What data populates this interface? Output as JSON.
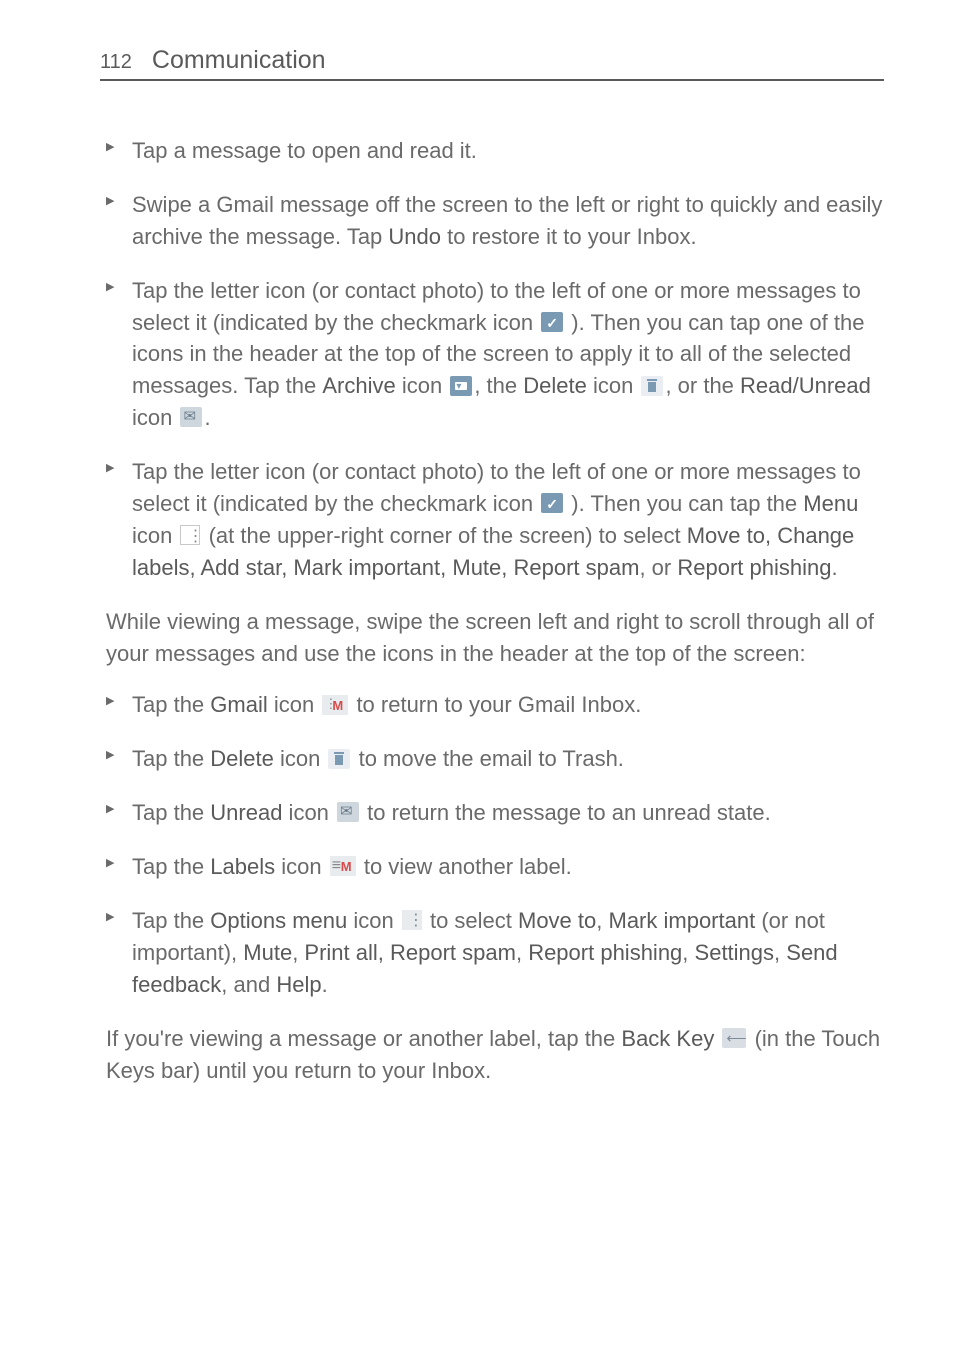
{
  "header": {
    "page_number": "112",
    "section": "Communication"
  },
  "list1": {
    "item1": "Tap a message to open and read it.",
    "item2_a": "Swipe a Gmail message off the screen to the left or right to quickly and easily archive the message. Tap ",
    "item2_b": "Undo",
    "item2_c": " to restore it to your Inbox.",
    "item3_a": "Tap the letter icon (or contact photo) to the left of one or more messages to select it (indicated by the checkmark icon ",
    "item3_b": " ). Then you can tap one of the icons in the header at the top of the screen to apply it to all of the selected messages. Tap the ",
    "item3_archive": "Archive",
    "item3_c": " icon ",
    "item3_d": ", the ",
    "item3_delete": "Delete",
    "item3_e": " icon ",
    "item3_f": ", or the ",
    "item3_readunread": "Read/Unread",
    "item3_g": " icon ",
    "item3_h": ".",
    "item4_a": "Tap the letter icon (or contact photo) to the left of one or more messages to select it (indicated by the checkmark icon ",
    "item4_b": " ). Then you can tap the ",
    "item4_menu": "Menu",
    "item4_c": " icon ",
    "item4_d": " (at the upper-right corner of the screen) to select ",
    "item4_options": "Move to, Change labels, Add star, Mark important, Mute, Report spam",
    "item4_e": ", or ",
    "item4_report": "Report phishing",
    "item4_f": "."
  },
  "para1": "While viewing a message, swipe the screen left and right to scroll through all of your messages and use the icons in the header at the top of the screen:",
  "list2": {
    "item1_a": "Tap the ",
    "item1_gmail": "Gmail",
    "item1_b": " icon ",
    "item1_c": " to return to your Gmail Inbox.",
    "item2_a": "Tap the ",
    "item2_delete": "Delete",
    "item2_b": " icon ",
    "item2_c": " to move the email to Trash.",
    "item3_a": "Tap the ",
    "item3_unread": "Unread",
    "item3_b": " icon ",
    "item3_c": " to return the message to an unread state.",
    "item4_a": "Tap the ",
    "item4_labels": "Labels",
    "item4_b": " icon ",
    "item4_c": " to view another label.",
    "item5_a": "Tap the ",
    "item5_options": "Options menu",
    "item5_b": " icon ",
    "item5_c": " to select ",
    "item5_move": "Move to",
    "item5_d": ", ",
    "item5_mark": "Mark important",
    "item5_e": " (or not important), ",
    "item5_list": "Mute",
    "item5_f": ", ",
    "item5_print": "Print all, Report spam",
    "item5_g": ", ",
    "item5_phish": "Report phishing",
    "item5_h": ", ",
    "item5_settings": "Settings",
    "item5_i": ", ",
    "item5_feedback": "Send feedback",
    "item5_j": ", and ",
    "item5_help": "Help",
    "item5_k": "."
  },
  "para2_a": "If you're viewing a message or another label, tap the ",
  "para2_back": "Back Key",
  "para2_b": " ",
  "para2_c": " (in the Touch Keys bar) until you return to your Inbox."
}
